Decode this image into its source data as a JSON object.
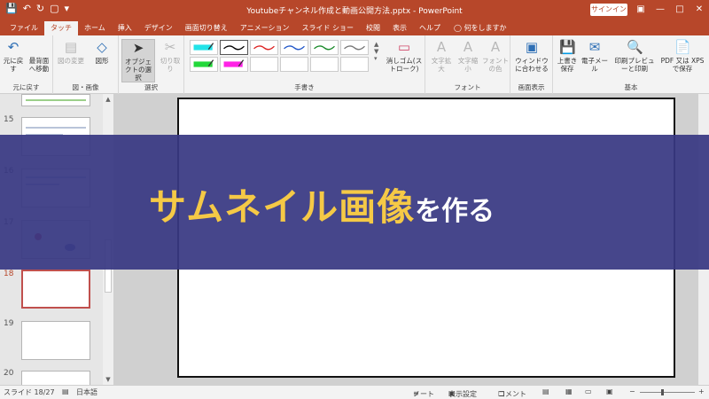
{
  "titlebar": {
    "title": "Youtubeチャンネル作成と動画公開方法.pptx - PowerPoint",
    "signin": "サインイン",
    "qat_icons": [
      "save-icon",
      "undo-icon",
      "redo-icon",
      "start-from-beginning-icon",
      "customize-icon"
    ]
  },
  "tabs": [
    "ファイル",
    "タッチ",
    "ホーム",
    "挿入",
    "デザイン",
    "画面切り替え",
    "アニメーション",
    "スライド ショー",
    "校閲",
    "表示",
    "ヘルプ"
  ],
  "active_tab": "タッチ",
  "tell_me": "何をしますか",
  "ribbon": {
    "undo_label": "元に戻す",
    "undo_first_label": "最背面へ移動",
    "undo_group": "元に戻す",
    "image_change": "図の変更",
    "shapes": "図形",
    "image_group": "図・画像",
    "select_object": "オブジェクトの選択",
    "cut": "切り取り",
    "select_group": "選択",
    "eraser": "消しゴム(ストローク)",
    "handwriting_group": "手書き",
    "text_enlarge": "文字拡大",
    "text_shrink": "文字縮小",
    "font_color": "フォントの色",
    "font_group": "フォント",
    "fit_window": "ウィンドウに合わせる",
    "view_group": "画面表示",
    "overwrite_save": "上書き保存",
    "email": "電子メール",
    "print_preview": "印刷プレビューと印刷",
    "pdf_xps": "PDF 又は XPS で保存",
    "basic_group": "基本"
  },
  "thumbnails": {
    "numbers": [
      "15",
      "16",
      "17",
      "18",
      "19",
      "20"
    ],
    "current": "18"
  },
  "banner": {
    "main_text": "サムネイル画像",
    "sub_text": "を作る"
  },
  "status": {
    "slide": "スライド 18/27",
    "language": "日本語",
    "notes": "ノート",
    "display_settings": "表示設定",
    "comments": "コメント"
  },
  "colors": {
    "accent": "#b7472a",
    "banner": "#383882",
    "banner_main_text": "#f5c946",
    "current_thumb": "#c0504d"
  }
}
